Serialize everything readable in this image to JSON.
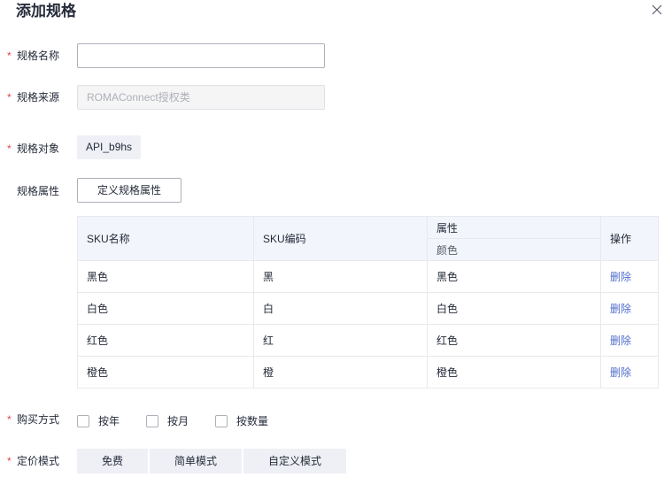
{
  "dialog": {
    "title": "添加规格"
  },
  "form": {
    "spec_name": {
      "label": "规格名称",
      "value": "",
      "placeholder": ""
    },
    "spec_source": {
      "label": "规格来源",
      "value": "ROMAConnect授权类"
    },
    "spec_object": {
      "label": "规格对象",
      "value": "API_b9hs"
    },
    "spec_attr": {
      "label": "规格属性",
      "button_label": "定义规格属性"
    },
    "purchase_method": {
      "label": "购买方式",
      "options": [
        {
          "label": "按年",
          "checked": false
        },
        {
          "label": "按月",
          "checked": false
        },
        {
          "label": "按数量",
          "checked": false
        }
      ]
    },
    "pricing_mode": {
      "label": "定价模式",
      "options": [
        "免费",
        "简单模式",
        "自定义模式"
      ]
    }
  },
  "sku_table": {
    "headers": {
      "sku_name": "SKU名称",
      "sku_code": "SKU编码",
      "attribute": "属性",
      "attribute_sub": "颜色",
      "action": "操作"
    },
    "rows": [
      {
        "name": "黑色",
        "code": "黑",
        "color": "黑色",
        "action": "删除"
      },
      {
        "name": "白色",
        "code": "白",
        "color": "白色",
        "action": "删除"
      },
      {
        "name": "红色",
        "code": "红",
        "color": "红色",
        "action": "删除"
      },
      {
        "name": "橙色",
        "code": "橙",
        "color": "橙色",
        "action": "删除"
      }
    ]
  },
  "colors": {
    "required_mark": "#e54545",
    "link": "#526ecc",
    "table_header_bg": "#f3f5fc"
  }
}
